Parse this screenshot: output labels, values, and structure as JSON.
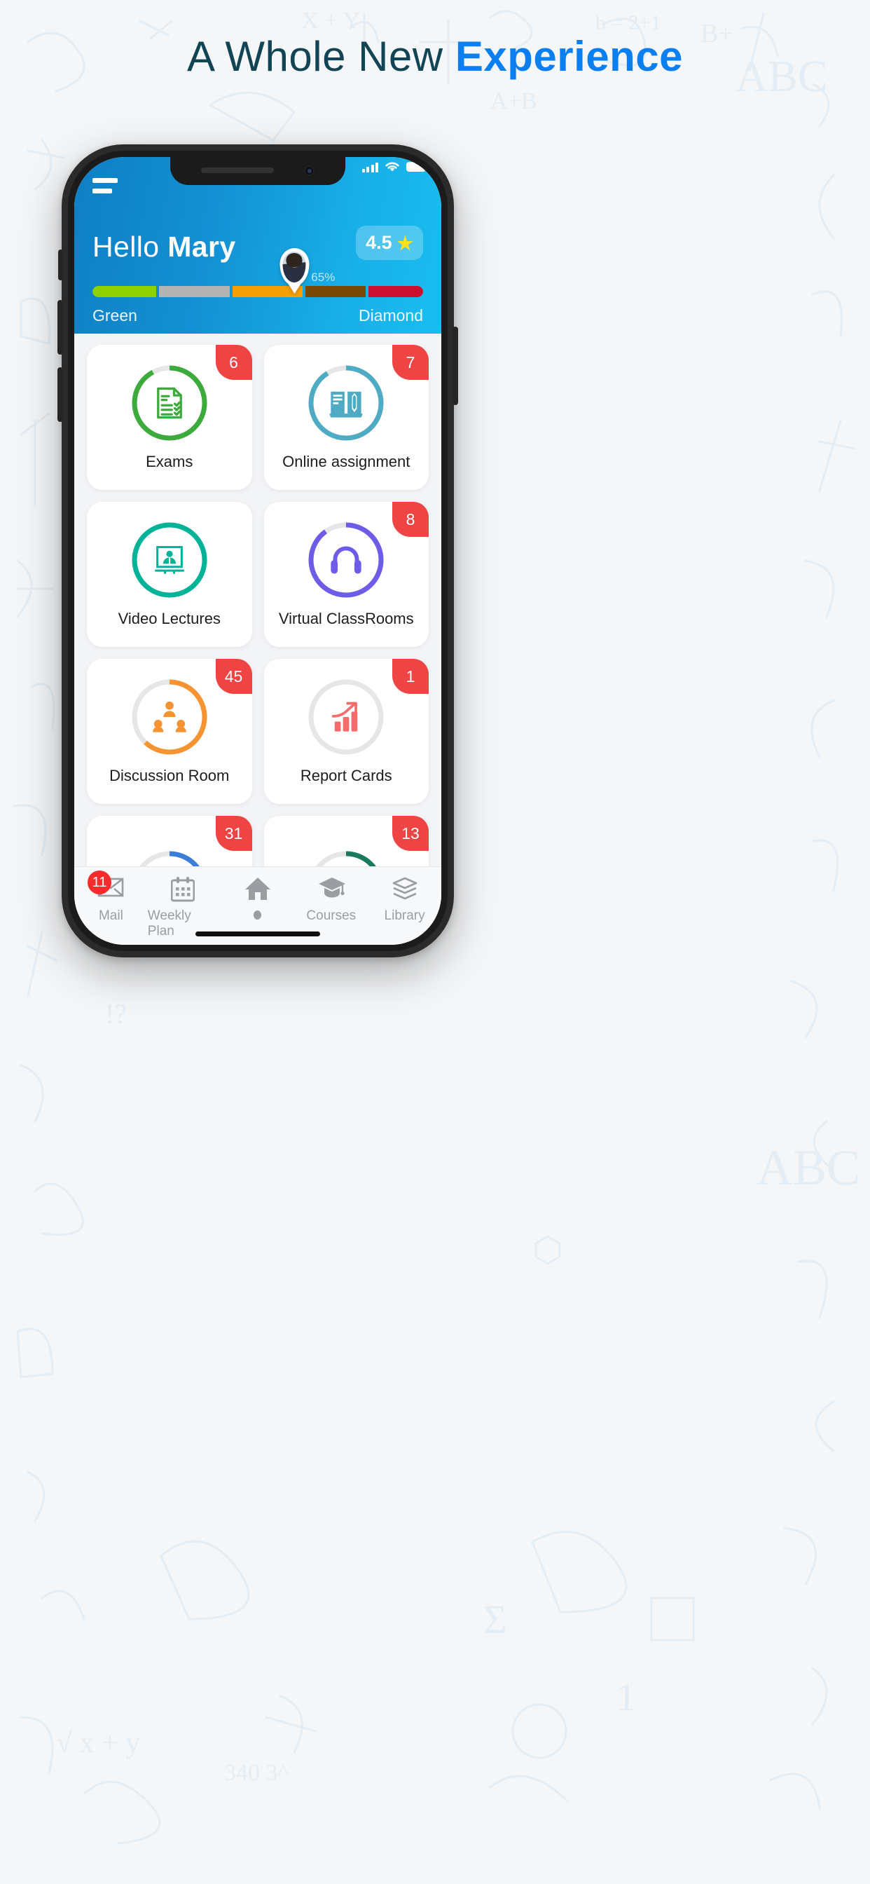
{
  "headline": {
    "plain": "A Whole New ",
    "accent": "Experience"
  },
  "colors": {
    "headline_plain": "#114454",
    "headline_accent": "#0b7ff0",
    "header_gradient_start": "#0f7fc4",
    "header_gradient_end": "#19bdf0",
    "badge_red": "#ef4444",
    "nav_grey": "#9a9da2",
    "page_bg": "#f4f6f8",
    "card_bg": "#ffffff",
    "grid_bg": "#f3f4f6"
  },
  "status_bar": {
    "signal_icon": "signal-bars-icon",
    "wifi_icon": "wifi-icon",
    "battery_icon": "battery-full-icon"
  },
  "header": {
    "menu_icon": "hamburger-menu-icon",
    "greeting_prefix": "Hello ",
    "user_name": "Mary",
    "rating_value": "4.5",
    "rating_star_icon": "star-icon",
    "avatar_icon": "user-avatar-pin",
    "progress": {
      "percent_label": "65%",
      "percent_value": 65,
      "left_tier": "Green",
      "right_tier": "Diamond",
      "segments": [
        {
          "name": "green",
          "color": "#8ed000",
          "width": 20
        },
        {
          "name": "silver",
          "color": "#b3b3b3",
          "width": 22
        },
        {
          "name": "gold",
          "color": "#f5a105",
          "width": 22
        },
        {
          "name": "bronze",
          "color": "#7a4907",
          "width": 19
        },
        {
          "name": "diamond",
          "color": "#cc1030",
          "width": 17
        }
      ]
    }
  },
  "grid": {
    "cards": [
      {
        "label": "Exams",
        "badge": "6",
        "ring_color": "#3cab3c",
        "ring_pct": 92,
        "icon": "checklist-document-icon"
      },
      {
        "label": "Online assignment",
        "badge": "7",
        "ring_color": "#4fabc4",
        "ring_pct": 91,
        "icon": "open-book-pencil-icon"
      },
      {
        "label": "Video Lectures",
        "badge": "",
        "ring_color": "#00b398",
        "ring_pct": 100,
        "icon": "video-presenter-icon"
      },
      {
        "label": "Virtual ClassRooms",
        "badge": "8",
        "ring_color": "#6c5ce7",
        "ring_pct": 90,
        "icon": "headphones-icon"
      },
      {
        "label": "Discussion Room",
        "badge": "45",
        "ring_color": "#f79431",
        "ring_pct": 62,
        "icon": "group-discussion-icon"
      },
      {
        "label": "Report Cards",
        "badge": "1",
        "ring_color": "#e0e0e0",
        "ring_pct": 0,
        "icon": "growth-chart-icon"
      },
      {
        "label": "",
        "badge": "31",
        "ring_color": "#3b7dd8",
        "ring_pct": 80,
        "icon": ""
      },
      {
        "label": "",
        "badge": "13",
        "ring_color": "#1a7a5e",
        "ring_pct": 78,
        "icon": ""
      }
    ]
  },
  "bottom_nav": {
    "items": [
      {
        "label": "Mail",
        "icon": "envelope-icon",
        "badge": "11",
        "active": false
      },
      {
        "label": "Weekly Plan",
        "icon": "calendar-icon",
        "badge": "",
        "active": false
      },
      {
        "label": "",
        "icon": "home-icon",
        "badge": "",
        "active": true
      },
      {
        "label": "Courses",
        "icon": "graduation-cap-icon",
        "badge": "",
        "active": false
      },
      {
        "label": "Library",
        "icon": "books-stack-icon",
        "badge": "",
        "active": false
      }
    ]
  }
}
